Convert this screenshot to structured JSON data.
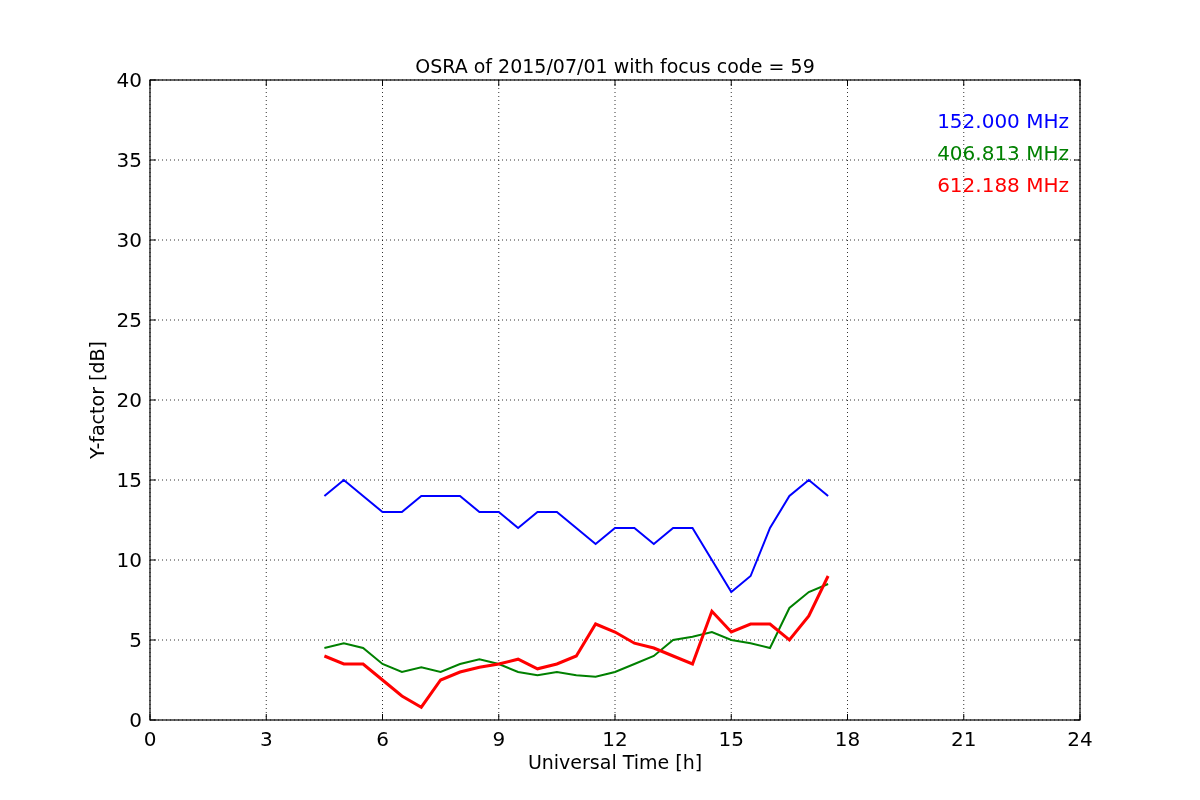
{
  "chart_data": {
    "type": "line",
    "grid": true,
    "title": "OSRA of 2015/07/01 with focus code = 59",
    "xlabel": "Universal Time [h]",
    "ylabel": "Y-factor [dB]",
    "x": [
      4.5,
      5,
      5.5,
      6,
      6.5,
      7,
      7.5,
      8,
      8.5,
      9,
      9.5,
      10,
      10.5,
      11,
      11.5,
      12,
      12.5,
      13,
      13.5,
      14,
      14.5,
      15,
      15.5,
      16,
      16.5,
      17,
      17.5
    ],
    "series": [
      {
        "name": "152.000 MHz",
        "color": "#0000ff",
        "values": [
          14,
          15,
          14,
          13,
          13,
          14,
          14,
          14,
          13,
          13,
          12,
          13,
          13,
          12,
          11,
          12,
          12,
          11,
          12,
          12,
          10,
          8,
          9,
          12,
          14,
          15,
          14
        ]
      },
      {
        "name": "406.813 MHz",
        "color": "#008000",
        "values": [
          4.5,
          4.8,
          4.5,
          3.5,
          3,
          3.3,
          3,
          3.5,
          3.8,
          3.5,
          3,
          2.8,
          3,
          2.8,
          2.7,
          3,
          3.5,
          4,
          5,
          5.2,
          5.5,
          5,
          4.8,
          4.5,
          7,
          8,
          8.5
        ]
      },
      {
        "name": "612.188 MHz",
        "color": "#ff0000",
        "values": [
          4,
          3.5,
          3.5,
          2.5,
          1.5,
          0.8,
          2.5,
          3,
          3.3,
          3.5,
          3.8,
          3.2,
          3.5,
          4,
          6,
          5.5,
          4.8,
          4.5,
          4,
          3.5,
          6.8,
          5.5,
          6,
          6,
          5,
          6.5,
          9
        ]
      }
    ],
    "xlim": [
      0,
      24
    ],
    "ylim": [
      0,
      40
    ],
    "xticks": [
      0,
      3,
      6,
      9,
      12,
      15,
      18,
      21,
      24
    ],
    "yticks": [
      0,
      5,
      10,
      15,
      20,
      25,
      30,
      35,
      40
    ]
  }
}
